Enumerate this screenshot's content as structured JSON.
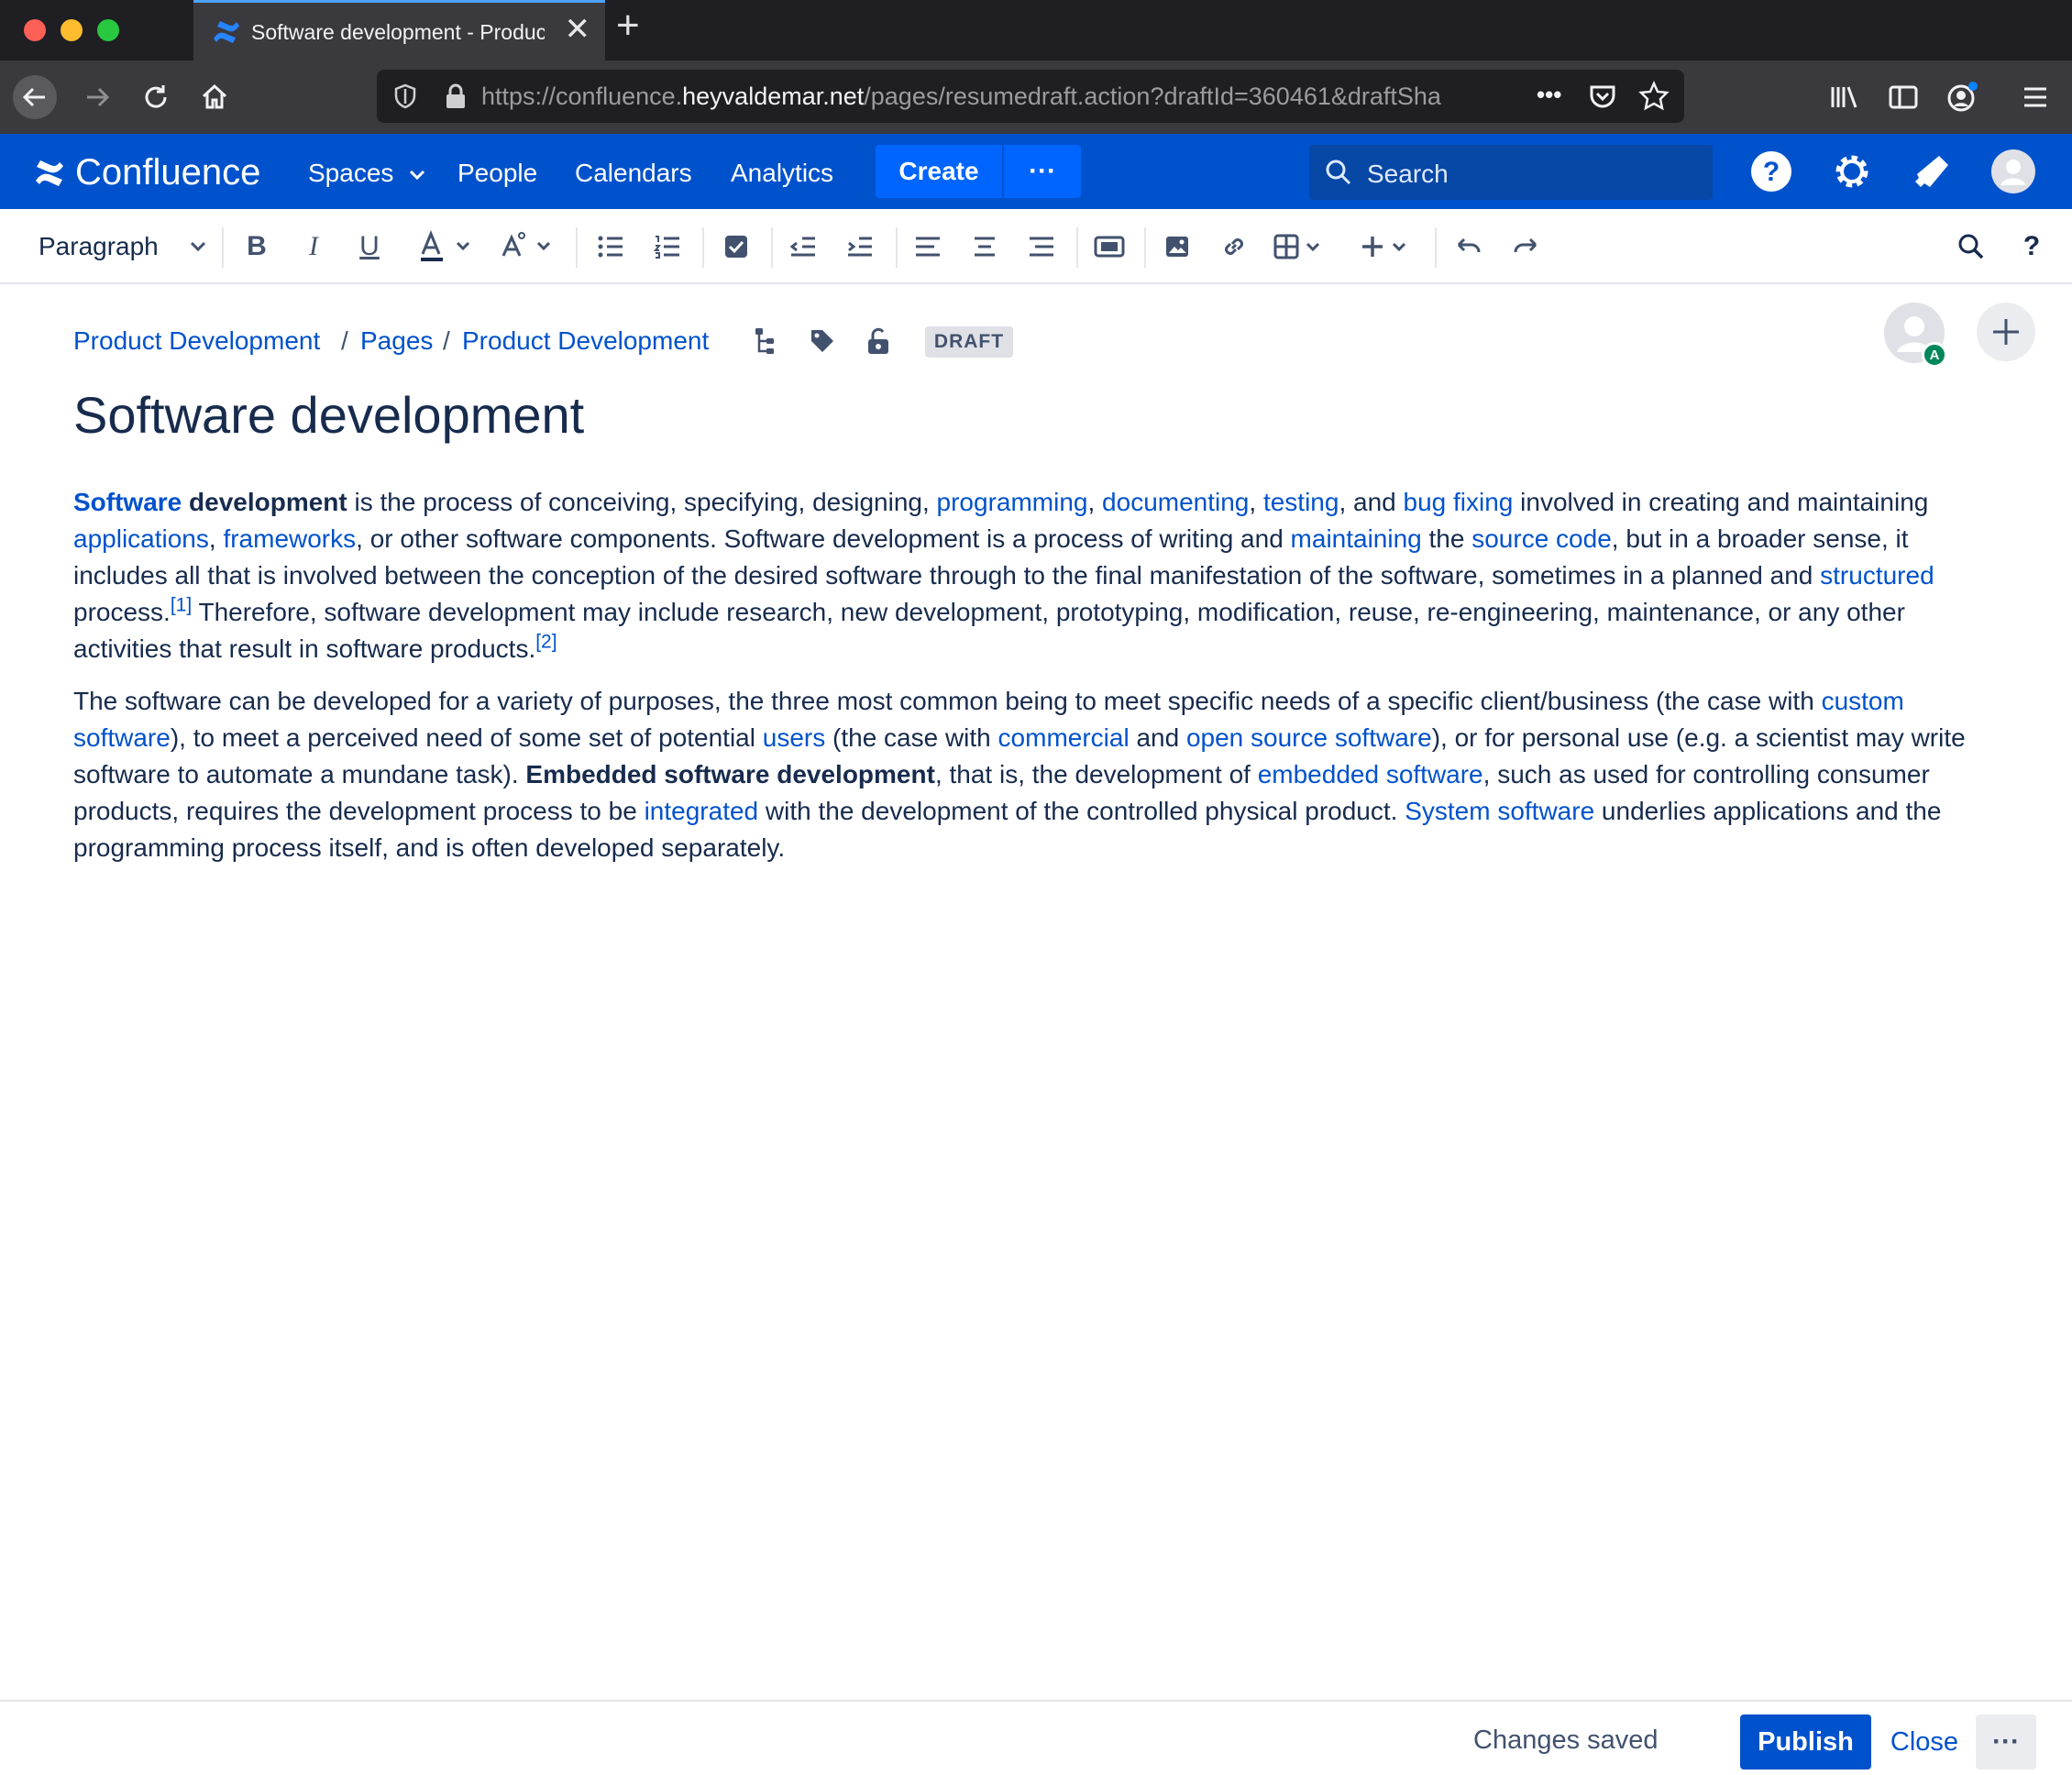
{
  "browser": {
    "tab_title": "Software development - Produc",
    "url_prefix": "https://confluence.",
    "url_domain": "heyvaldemar.net",
    "url_path": "/pages/resumedraft.action?draftId=360461&draftSha",
    "url_more": "•••"
  },
  "header": {
    "app_name": "Confluence",
    "nav": [
      "Spaces",
      "People",
      "Calendars",
      "Analytics"
    ],
    "create_label": "Create",
    "more_label": "···",
    "search_placeholder": "Search"
  },
  "toolbar": {
    "style_select": "Paragraph"
  },
  "breadcrumb": {
    "items": [
      "Product Development",
      "Pages",
      "Product Development"
    ],
    "separator": "/",
    "status": "DRAFT"
  },
  "collaborator": {
    "badge": "A"
  },
  "page": {
    "title": "Software development",
    "p1": {
      "t1": "Software",
      "t2": "development",
      "t3": " is the process of conceiving, specifying, designing, ",
      "l1": "programming",
      "t4": ", ",
      "l2": "documenting",
      "t5": ", ",
      "l3": "testing",
      "t6": ", and ",
      "l4": "bug fixing",
      "t7": " involved in creating and maintaining ",
      "l5": "applications",
      "t8": ", ",
      "l6": "frameworks",
      "t9": ", or other software components. Software development is a process of writing and ",
      "l7": "maintaining",
      "t10": " the ",
      "l8": "source code",
      "t11": ", but in a broader sense, it includes all that is involved between the conception of the desired software through to the final manifestation of the software, sometimes in a planned and ",
      "l9": "structured",
      "t12": " process.",
      "ref1": "[1]",
      "t13": " Therefore, software development may include research, new development, prototyping, modification, reuse, re-engineering, maintenance, or any other activities that result in software products.",
      "ref2": "[2]"
    },
    "p2": {
      "t1": "The software can be developed for a variety of purposes, the three most common being to meet specific needs of a specific client/business (the case with ",
      "l1": "custom software",
      "t2": "), to meet a perceived need of some set of potential ",
      "l2": "users",
      "t3": " (the case with ",
      "l3": "commercial",
      "t4": " and ",
      "l4": "open source software",
      "t5": "), or for personal use (e.g. a scientist may write software to automate a mundane task). ",
      "b1": "Embedded software development",
      "t6": ", that is, the development of ",
      "l5": "embedded software",
      "t7": ", such as used for controlling consumer products, requires the development process to be ",
      "l6": "integrated",
      "t8": " with the development of the controlled physical product. ",
      "l7": "System software",
      "t9": " underlies applications and the programming process itself, and is often developed separately."
    }
  },
  "footer": {
    "status": "Changes saved",
    "publish_label": "Publish",
    "close_label": "Close",
    "more_label": "···"
  },
  "colors": {
    "brand": "#0052cc",
    "create": "#0065ff",
    "text": "#172b4d"
  }
}
